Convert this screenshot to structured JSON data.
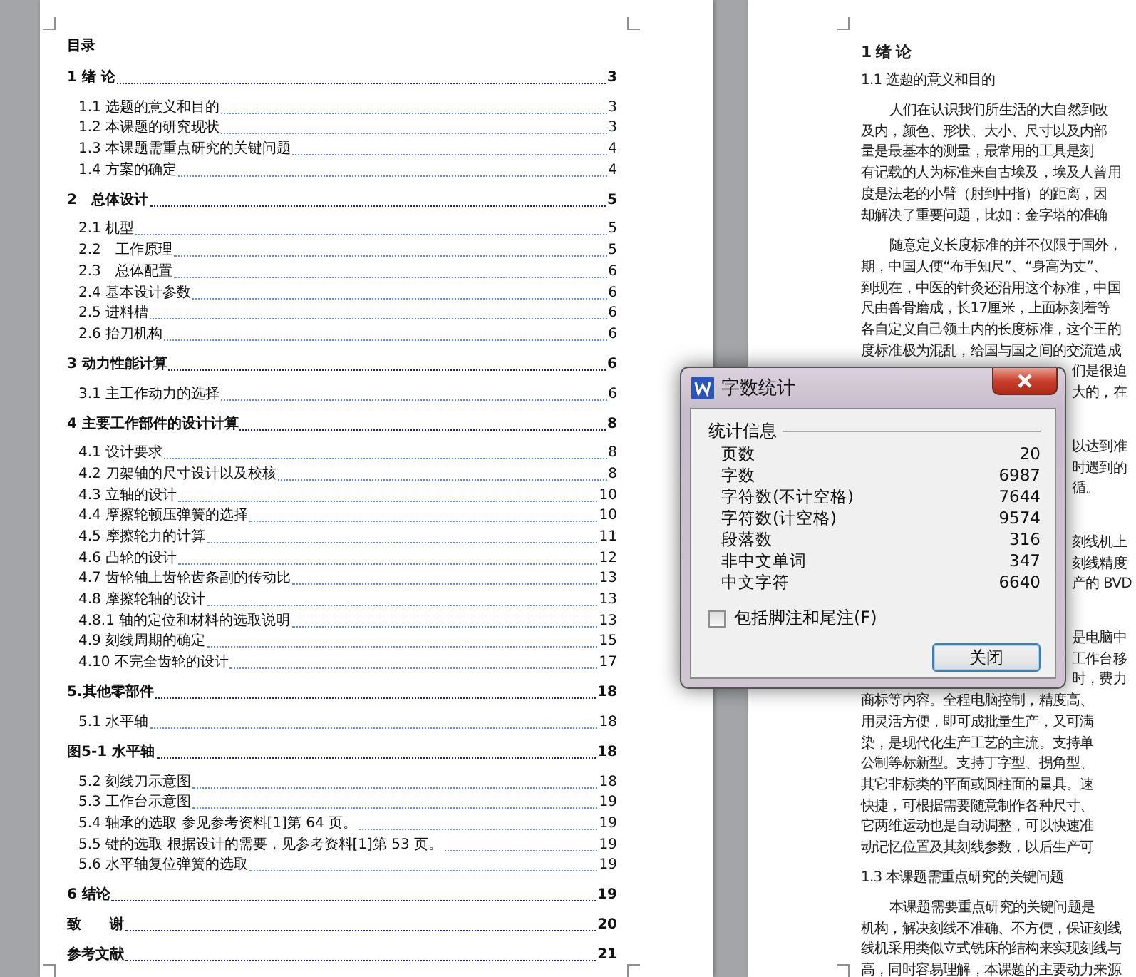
{
  "toc": {
    "title": "目录",
    "entries": [
      {
        "text": "1 绪 论",
        "page": "3",
        "children": [
          {
            "text": "1.1 选题的意义和目的",
            "page": "3"
          },
          {
            "text": "1.2 本课题的研究现状",
            "page": "3"
          },
          {
            "text": "1.3 本课题需重点研究的关键问题",
            "page": "4"
          },
          {
            "text": "1.4 方案的确定",
            "page": "4"
          }
        ]
      },
      {
        "text": "2　总体设计",
        "page": "5",
        "children": [
          {
            "text": "2.1 机型",
            "page": "5"
          },
          {
            "text": "2.2　工作原理",
            "page": "5"
          },
          {
            "text": "2.3　总体配置",
            "page": "6"
          },
          {
            "text": "2.4 基本设计参数",
            "page": "6"
          },
          {
            "text": "2.5 进料槽",
            "page": "6"
          },
          {
            "text": "2.6 抬刀机构",
            "page": "6"
          }
        ]
      },
      {
        "text": "3 动力性能计算",
        "page": "6",
        "children": [
          {
            "text": "3.1 主工作动力的选择",
            "page": "6"
          }
        ]
      },
      {
        "text": "4 主要工作部件的设计计算",
        "page": "8",
        "children": [
          {
            "text": "4.1 设计要求",
            "page": "8"
          },
          {
            "text": "4.2 刀架轴的尺寸设计以及校核",
            "page": "8"
          },
          {
            "text": "4.3 立轴的设计",
            "page": "10"
          },
          {
            "text": "4.4 摩擦轮顿压弹簧的选择",
            "page": "10"
          },
          {
            "text": "4.5 摩擦轮力的计算",
            "page": "11"
          },
          {
            "text": "4.6 凸轮的设计",
            "page": "12"
          },
          {
            "text": "4.7 齿轮轴上齿轮齿条副的传动比",
            "page": "13"
          },
          {
            "text": "4.8 摩擦轮轴的设计",
            "page": "13"
          },
          {
            "text": "4.8.1 轴的定位和材料的选取说明",
            "page": "13"
          },
          {
            "text": "4.9 刻线周期的确定",
            "page": "15"
          },
          {
            "text": "4.10 不完全齿轮的设计",
            "page": "17"
          }
        ]
      },
      {
        "text": "5.其他零部件",
        "page": "18",
        "children": [
          {
            "text": "5.1 水平轴",
            "page": "18"
          }
        ]
      },
      {
        "text": "图5-1 水平轴",
        "page": "18",
        "children": [
          {
            "text": "5.2 刻线刀示意图",
            "page": "18"
          },
          {
            "text": "5.3 工作台示意图",
            "page": "19"
          },
          {
            "text": "5.4 轴承的选取 参见参考资料[1]第 64 页。",
            "page": "19"
          },
          {
            "text": "5.5 键的选取 根据设计的需要，见参考资料[1]第 53 页。",
            "page": "19"
          },
          {
            "text": "5.6 水平轴复位弹簧的选取",
            "page": "19"
          }
        ]
      },
      {
        "text": "6 结论",
        "page": "19"
      },
      {
        "text": "致　　谢",
        "page": "20"
      },
      {
        "text": "参考文献",
        "page": "21"
      }
    ]
  },
  "document": {
    "heading": "1 绪 论",
    "blocks": [
      {
        "kind": "subheading",
        "text": "1.1 选题的意义和目的"
      },
      {
        "kind": "paragraph",
        "lines": [
          {
            "kind": "first",
            "text": "人们在认识我们所生活的大自然到改"
          },
          {
            "kind": "full",
            "text": "及内，颜色、形状、大小、尺寸以及内部"
          },
          {
            "kind": "full",
            "text": "量是最基本的测量，最常用的工具是刻"
          },
          {
            "kind": "full",
            "text": "有记载的人为标准来自古埃及，埃及人曾用"
          },
          {
            "kind": "full",
            "text": "度是法老的小臂（肘到中指）的距离，因"
          },
          {
            "kind": "full",
            "text": "却解决了重要问题，比如：金字塔的准确"
          }
        ]
      },
      {
        "kind": "paragraph",
        "lines": [
          {
            "kind": "first",
            "text": "随意定义长度标准的并不仅限于国外，"
          },
          {
            "kind": "full",
            "text": "期，中国人便“布手知尺”、“身高为丈”、"
          },
          {
            "kind": "full",
            "text": "到现在，中医的针灸还沿用这个标准，中国"
          },
          {
            "kind": "full",
            "text": "尺由兽骨磨成，长17厘米，上面标刻着等"
          },
          {
            "kind": "full",
            "text": "各自定义自己领土内的长度标准，这个王的"
          },
          {
            "kind": "full",
            "text": "度标准极为混乱，给国与国之间的交流造成"
          },
          {
            "kind": "tail",
            "text": "们是很迫"
          },
          {
            "kind": "tail",
            "text": "大的，在"
          }
        ]
      },
      {
        "kind": "paragraph",
        "lines": [
          {
            "kind": "tail",
            "text": "以达到准"
          },
          {
            "kind": "tail",
            "text": "时遇到的"
          },
          {
            "kind": "tail",
            "text": "循。"
          }
        ]
      },
      {
        "kind": "paragraph",
        "lines": [
          {
            "kind": "tail",
            "text": "刻线机上"
          },
          {
            "kind": "tail",
            "text": "刻线精度"
          },
          {
            "kind": "tail",
            "text": "产的 BVD"
          }
        ]
      },
      {
        "kind": "paragraph",
        "lines": [
          {
            "kind": "tail",
            "text": "是电脑中"
          },
          {
            "kind": "tail",
            "text": "工作台移"
          },
          {
            "kind": "tail",
            "text": "时，费力"
          },
          {
            "kind": "full",
            "text": "商标等内容。全程电脑控制，精度高、"
          },
          {
            "kind": "full",
            "text": "用灵活方便，即可成批量生产，又可满"
          },
          {
            "kind": "full",
            "text": "染，是现代化生产工艺的主流。支持单"
          },
          {
            "kind": "full",
            "text": "公制等标新型。支持丁字型、拐角型、"
          },
          {
            "kind": "full",
            "text": "其它非标类的平面或圆柱面的量具。速"
          },
          {
            "kind": "full",
            "text": "快捷，可根据需要随意制作各种尺寸、"
          },
          {
            "kind": "full",
            "text": "它两维运动也是自动调整，可以快速准"
          },
          {
            "kind": "full",
            "text": "动记忆位置及其刻线参数，以后生产可"
          }
        ]
      },
      {
        "kind": "subheading",
        "text": "1.3 本课题需重点研究的关键问题"
      },
      {
        "kind": "paragraph",
        "lines": [
          {
            "kind": "first",
            "text": "本课题需要重点研究的关键问题是"
          },
          {
            "kind": "full",
            "text": "机构，解决刻线不准确、不方便，保证刻线"
          },
          {
            "kind": "full",
            "text": "线机采用类似立式铣床的结构来实现刻线与"
          },
          {
            "kind": "full",
            "text": "高，同时容易理解，本课题的主要动力来源"
          }
        ]
      }
    ]
  },
  "dialog": {
    "title": "字数统计",
    "group": "统计信息",
    "stats": [
      {
        "label": "页数",
        "value": "20"
      },
      {
        "label": "字数",
        "value": "6987"
      },
      {
        "label": "字符数(不计空格)",
        "value": "7644"
      },
      {
        "label": "字符数(计空格)",
        "value": "9574"
      },
      {
        "label": "段落数",
        "value": "316"
      },
      {
        "label": "非中文单词",
        "value": "347"
      },
      {
        "label": "中文字符",
        "value": "6640"
      }
    ],
    "checkbox": {
      "label": "包括脚注和尾注(F)",
      "checked": false
    },
    "button": "关闭"
  }
}
